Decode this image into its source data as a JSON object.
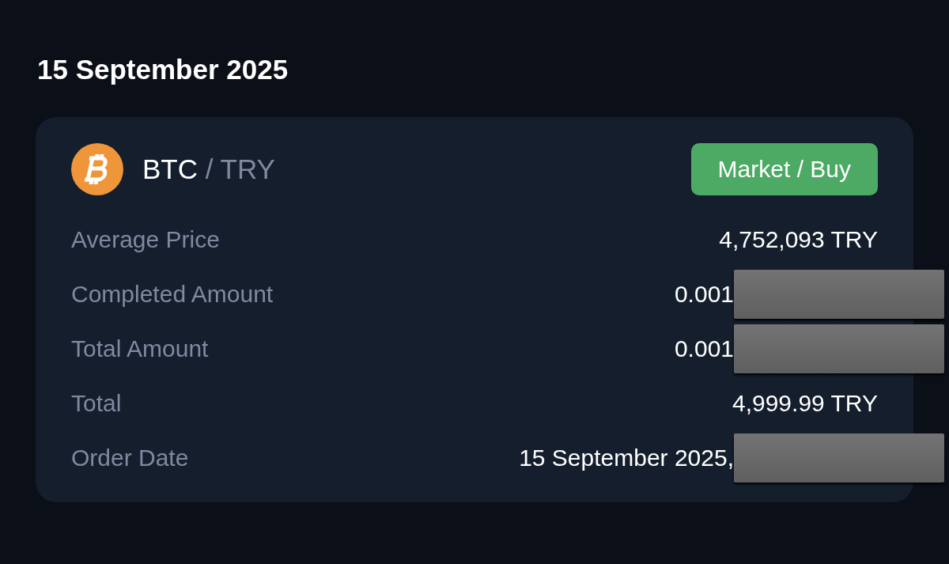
{
  "date_heading": "15 September 2025",
  "order": {
    "base": "BTC",
    "quote": "/ TRY",
    "badge": "Market / Buy",
    "rows": [
      {
        "label": "Average Price",
        "value": "4,752,093 TRY",
        "redacted": false
      },
      {
        "label": "Completed Amount",
        "value": "0.001",
        "redacted": true
      },
      {
        "label": "Total Amount",
        "value": "0.001",
        "redacted": true
      },
      {
        "label": "Total",
        "value": "4,999.99 TRY",
        "redacted": false
      },
      {
        "label": "Order Date",
        "value": "15 September 2025,",
        "redacted": true
      }
    ]
  }
}
